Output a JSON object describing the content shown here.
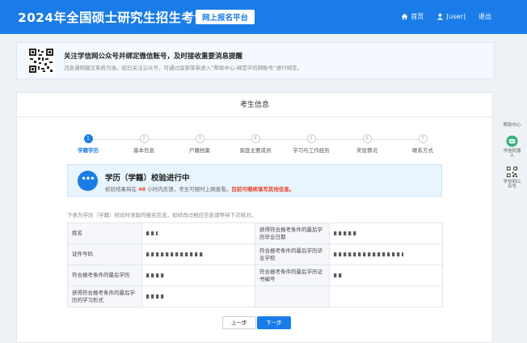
{
  "header": {
    "title": "2024年全国硕士研究生招生考试",
    "platform": "网上报名平台"
  },
  "nav": {
    "home": "首页",
    "user": "[user]",
    "logout": "退出"
  },
  "notice": {
    "title": "关注学信网公众号并绑定微信账号，及时接收重要消息提醒",
    "subtitle": "消息通知建议系统为准。如已关注公众号，可通过底部菜单进入“帮助中心-绑定学信网账号”进行绑定。"
  },
  "card": {
    "title": "考生信息"
  },
  "steps": [
    {
      "num": "1",
      "label": "学籍学历"
    },
    {
      "num": "2",
      "label": "基本信息"
    },
    {
      "num": "3",
      "label": "户籍档案"
    },
    {
      "num": "4",
      "label": "家庭主要成员"
    },
    {
      "num": "5",
      "label": "学习与工作经历"
    },
    {
      "num": "6",
      "label": "奖惩情况"
    },
    {
      "num": "7",
      "label": "联系方式"
    }
  ],
  "status": {
    "title": "学历（学籍）校验进行中",
    "desc_prefix": "校验结果将在 ",
    "desc_hours": "48",
    "desc_middle": " 小时内反馈，考生可随时上网查看。",
    "desc_highlight": "目前可继续填写其他信息。"
  },
  "table_note": "下表为学历（学籍）校验时读取的报名信息，如修改过相应信息请等待下次核对。",
  "table": {
    "rows": [
      {
        "label1": "姓名",
        "label2": "获得符合报考条件的最后学历毕业日期"
      },
      {
        "label1": "证件号码",
        "label2": "符合报考条件的最后学历毕业学校"
      },
      {
        "label1": "符合报考条件的最后学历",
        "label2": "符合报考条件的最后学历证书编号"
      },
      {
        "label1": "获得符合报考条件的最后学历的学习形式",
        "label2": ""
      }
    ]
  },
  "buttons": {
    "prev": "上一步",
    "next": "下一步"
  },
  "side_tools": {
    "help": "帮助中心",
    "robot": "学信机器人",
    "wechat": "学信网公众号"
  },
  "colors": {
    "primary": "#1a7ce8",
    "highlight": "#e9432a"
  }
}
